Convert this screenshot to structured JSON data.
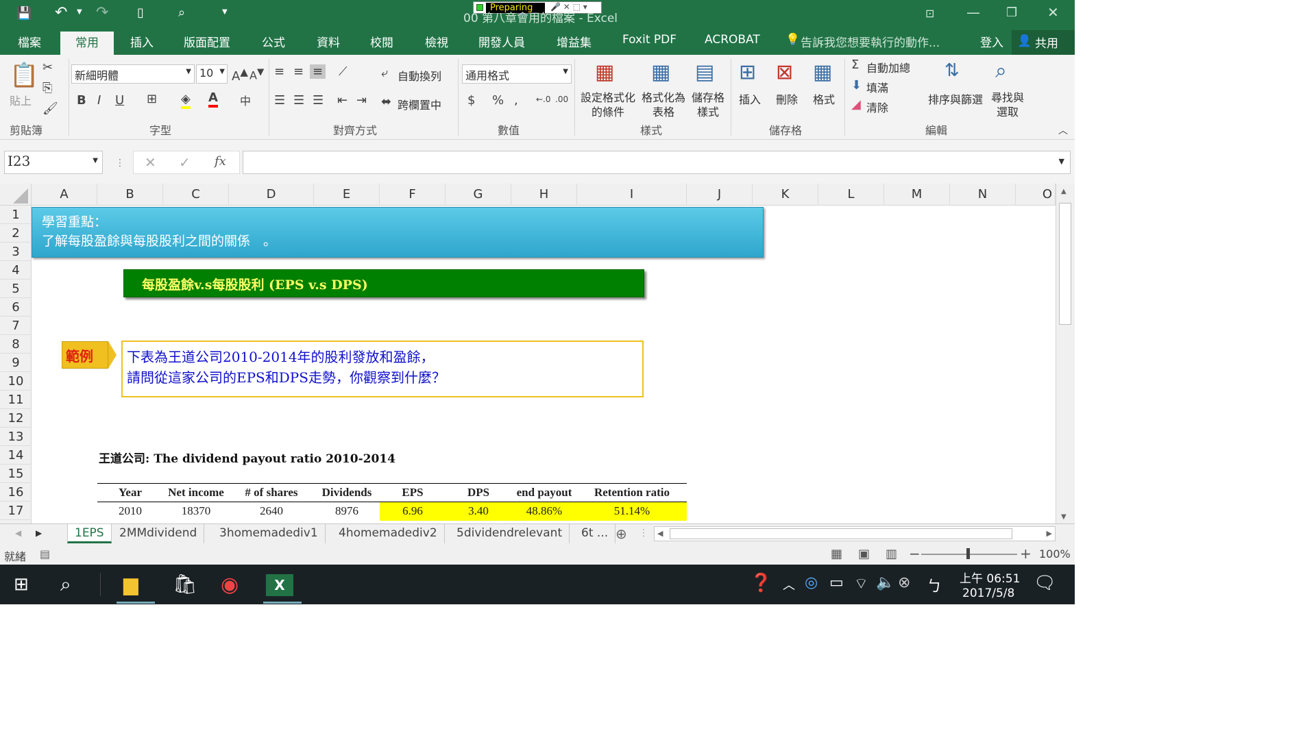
{
  "window": {
    "title": "00 第八章會用的檔案 - Excel",
    "recorder_label": "Preparing"
  },
  "tabs": [
    "檔案",
    "常用",
    "插入",
    "版面配置",
    "公式",
    "資料",
    "校閱",
    "檢視",
    "開發人員",
    "增益集",
    "Foxit PDF",
    "ACROBAT"
  ],
  "active_tab": "常用",
  "tell_me": "告訴我您想要執行的動作...",
  "signin": "登入",
  "share": "共用",
  "ribbon": {
    "clipboard": {
      "paste": "貼上",
      "group": "剪貼簿"
    },
    "font": {
      "name": "新細明體",
      "size": "10",
      "group": "字型"
    },
    "align": {
      "wrap": "自動換列",
      "merge": "跨欄置中",
      "group": "對齊方式"
    },
    "number": {
      "format": "通用格式",
      "group": "數值"
    },
    "styles": {
      "cond": "設定格式化的條件",
      "table": "格式化為表格",
      "cell": "儲存格樣式",
      "group": "樣式"
    },
    "cells": {
      "insert": "插入",
      "delete": "刪除",
      "format": "格式",
      "group": "儲存格"
    },
    "editing": {
      "autosum": "自動加總",
      "fill": "填滿",
      "clear": "清除",
      "sort": "排序與篩選",
      "find": "尋找與選取",
      "group": "編輯"
    }
  },
  "formula_bar": {
    "name_box": "I23",
    "fx": "fx",
    "value": ""
  },
  "columns": [
    "A",
    "B",
    "C",
    "D",
    "E",
    "F",
    "G",
    "H",
    "I",
    "J",
    "K",
    "L",
    "M",
    "N",
    "O"
  ],
  "rows": [
    "1",
    "2",
    "3",
    "4",
    "5",
    "6",
    "7",
    "8",
    "9",
    "10",
    "11",
    "12",
    "13",
    "14",
    "15",
    "16",
    "17"
  ],
  "sheet": {
    "banner_line1": "學習重點：",
    "banner_line2": "了解每股盈餘與每股股利之間的關係　。",
    "title_box": "每股盈餘v.s每股股利  (EPS v.s DPS)",
    "example_tag": "範例",
    "example_line1": "下表為王道公司2010-2014年的股利發放和盈餘，",
    "example_line2": "請問從這家公司的EPS和DPS走勢，你觀察到什麼？",
    "table_title": "王道公司: The dividend payout ratio 2010-2014",
    "headers": [
      "Year",
      "Net income",
      "# of shares",
      "Dividends",
      "EPS",
      "DPS",
      "end payout",
      "Retention ratio"
    ],
    "row1": [
      "2010",
      "18370",
      "2640",
      "8976",
      "6.96",
      "3.40",
      "48.86%",
      "51.14%"
    ]
  },
  "sheet_tabs": [
    "1EPS",
    "2MMdividend",
    "3homemadediv1",
    "4homemadediv2",
    "5dividendrelevant",
    "6t ..."
  ],
  "status": {
    "ready": "就緒",
    "zoom": "100%"
  },
  "taskbar": {
    "time": "上午 06:51",
    "date": "2017/5/8"
  },
  "colors": {
    "excel_green": "#217346",
    "banner_blue": "#3eb6d8",
    "title_green": "#008000",
    "highlight_yellow": "#ffff00",
    "example_gold": "#f0c020"
  }
}
